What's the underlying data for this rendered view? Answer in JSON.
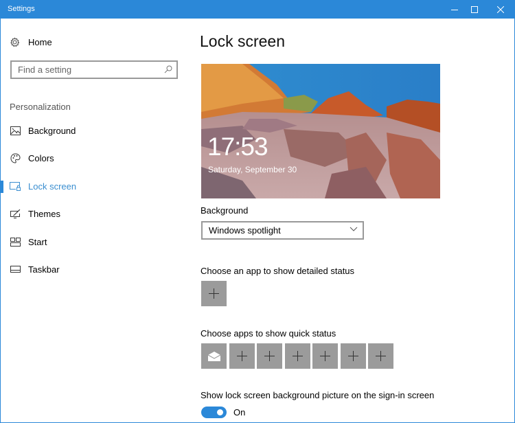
{
  "window": {
    "title": "Settings",
    "controls": {
      "minimize": "minimize-icon",
      "maximize": "maximize-icon",
      "close": "close-icon"
    },
    "accent_color": "#2b88d8"
  },
  "sidebar": {
    "home_label": "Home",
    "search_placeholder": "Find a setting",
    "section_label": "Personalization",
    "items": [
      {
        "label": "Background",
        "icon": "picture-icon",
        "active": false
      },
      {
        "label": "Colors",
        "icon": "palette-icon",
        "active": false
      },
      {
        "label": "Lock screen",
        "icon": "lock-screen-icon",
        "active": true
      },
      {
        "label": "Themes",
        "icon": "themes-icon",
        "active": false
      },
      {
        "label": "Start",
        "icon": "start-icon",
        "active": false
      },
      {
        "label": "Taskbar",
        "icon": "taskbar-icon",
        "active": false
      }
    ]
  },
  "main": {
    "title": "Lock screen",
    "preview": {
      "time": "17:53",
      "date": "Saturday, September 30"
    },
    "background_label": "Background",
    "background_value": "Windows spotlight",
    "detailed_status_label": "Choose an app to show detailed status",
    "quick_status_label": "Choose apps to show quick status",
    "quick_status_tiles": [
      "mail-icon",
      "plus-icon",
      "plus-icon",
      "plus-icon",
      "plus-icon",
      "plus-icon",
      "plus-icon"
    ],
    "signin_label": "Show lock screen background picture on the sign-in screen",
    "signin_toggle": {
      "state": "On",
      "on": true
    }
  }
}
